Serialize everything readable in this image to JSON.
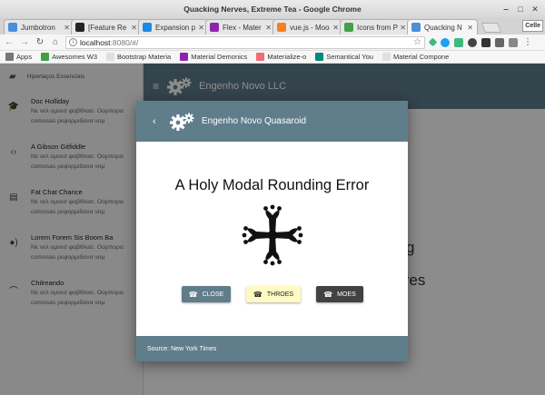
{
  "window": {
    "title": "Quacking Nerves, Extreme Tea - Google Chrome"
  },
  "tabs": [
    {
      "title": "Jumbotron",
      "color": "#4a90d9"
    },
    {
      "title": "[Feature Re",
      "color": "#222222"
    },
    {
      "title": "Expansion p",
      "color": "#1e88e5"
    },
    {
      "title": "Flex - Mater",
      "color": "#8e24aa"
    },
    {
      "title": "vue.js - Moo",
      "color": "#f48024"
    },
    {
      "title": "Icons from P",
      "color": "#43a047"
    },
    {
      "title": "Quacking N",
      "color": "#4a90d9"
    }
  ],
  "profile_label": "Celle",
  "address": {
    "host": "localhost",
    "rest": ":8080/#/"
  },
  "bookmarks": [
    {
      "label": "Apps",
      "color": "#777777"
    },
    {
      "label": "Awesomes W3",
      "color": "#43a047"
    },
    {
      "label": "Bootstrap Materia",
      "color": "#e0e0e0"
    },
    {
      "label": "Material Demonics",
      "color": "#8e24aa"
    },
    {
      "label": "Materialize-o",
      "color": "#ee6e73"
    },
    {
      "label": "Semantical You",
      "color": "#00897b"
    },
    {
      "label": "Material Compone",
      "color": "#e0e0e0"
    }
  ],
  "sidebar": {
    "header": "Hiperlaços Essenciais",
    "items": [
      {
        "title": "Doc Holliday",
        "subtitle": "Νε νελ ομνεσ φαβθλασ. Οορπορα",
        "subtitle2": "comosas ρεφορμιδανα νομ",
        "icon": "school-icon"
      },
      {
        "title": "A Gibson Gitfiddle",
        "subtitle": "Νε νελ ομνεσ φαβθλασ. Οορπορα",
        "subtitle2": "comosas ρεφορμιδανα νομ",
        "icon": "code-icon"
      },
      {
        "title": "Fat Chat Chance",
        "subtitle": "Νε νελ ομνεσ φαβθλασ. Οορπορα",
        "subtitle2": "comosas ρεφορμιδανα νομ",
        "icon": "chat-icon"
      },
      {
        "title": "Lorem Forem Sis Boom Ba",
        "subtitle": "Νε νελ ομνεσ φαβθλασ. Οορπορα",
        "subtitle2": "comosas ρεφορμιδανα νομ",
        "icon": "record-voice-icon"
      },
      {
        "title": "Chilreando",
        "subtitle": "Νε νελ ομνεσ φαβθλασ. Οορπορα",
        "subtitle2": "comosas ρεφορμιδανα νομ",
        "icon": "rss-icon"
      }
    ]
  },
  "appbar": {
    "title": "Engenho Novo LLC"
  },
  "background_fragments": {
    "a": "g",
    "b": "tres"
  },
  "modal": {
    "header": "Engenho Novo Quasaroid",
    "title": "A Holy Modal Rounding Error",
    "buttons": {
      "close": "CLOSE",
      "throes": "THROES",
      "moes": "MOES"
    },
    "footer": "Source: New York Times"
  },
  "colors": {
    "primary": "#607d8b",
    "throes": "#fff9c4",
    "moes": "#424242"
  }
}
